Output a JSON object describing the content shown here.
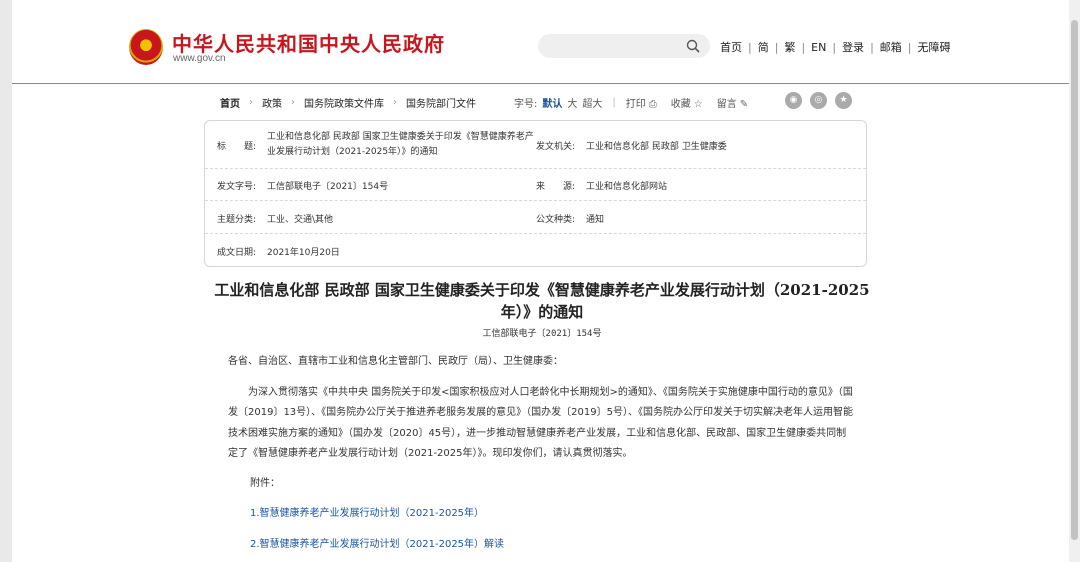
{
  "site": {
    "title": "中华人民共和国中央人民政府",
    "url": "www.gov.cn"
  },
  "search": {
    "value": "",
    "placeholder": ""
  },
  "topnav": {
    "items": [
      "首页",
      "简",
      "繁",
      "EN",
      "登录",
      "邮箱",
      "无障碍"
    ]
  },
  "breadcrumb": {
    "items": [
      "首页",
      "政策",
      "国务院政策文件库",
      "国务院部门文件"
    ]
  },
  "tools": {
    "font_label": "字号:",
    "font_default": "默认",
    "font_large": "大",
    "font_xlarge": "超大",
    "print": "打印",
    "favorite": "收藏",
    "message": "留言"
  },
  "meta": {
    "title_label": "标　　题:",
    "title_value": "工业和信息化部 民政部 国家卫生健康委关于印发《智慧健康养老产业发展行动计划（2021-2025年）》的通知",
    "issuer_label": "发文机关:",
    "issuer_value": "工业和信息化部 民政部 卫生健康委",
    "docno_label": "发文字号:",
    "docno_value": "工信部联电子〔2021〕154号",
    "source_label": "来　　源:",
    "source_value": "工业和信息化部网站",
    "category_label": "主题分类:",
    "category_value": "工业、交通\\其他",
    "doctype_label": "公文种类:",
    "doctype_value": "通知",
    "date_label": "成文日期:",
    "date_value": "2021年10月20日"
  },
  "article": {
    "title": "工业和信息化部 民政部 国家卫生健康委关于印发《智慧健康养老产业发展行动计划（2021-2025年）》的通知",
    "doc_number": "工信部联电子〔2021〕154号",
    "salutation": "各省、自治区、直辖市工业和信息化主管部门、民政厅（局）、卫生健康委：",
    "paragraph": "为深入贯彻落实《中共中央 国务院关于印发<国家积极应对人口老龄化中长期规划>的通知》、《国务院关于实施健康中国行动的意见》（国发〔2019〕13号）、《国务院办公厅关于推进养老服务发展的意见》（国办发〔2019〕5号）、《国务院办公厅印发关于切实解决老年人运用智能技术困难实施方案的通知》（国办发〔2020〕45号），进一步推动智慧健康养老产业发展，工业和信息化部、民政部、国家卫生健康委共同制定了《智慧健康养老产业发展行动计划（2021-2025年）》。现印发你们，请认真贯彻落实。",
    "attachment_label": "附件：",
    "attachments": [
      "1.智慧健康养老产业发展行动计划（2021-2025年）",
      "2.智慧健康养老产业发展行动计划（2021-2025年）解读"
    ]
  }
}
